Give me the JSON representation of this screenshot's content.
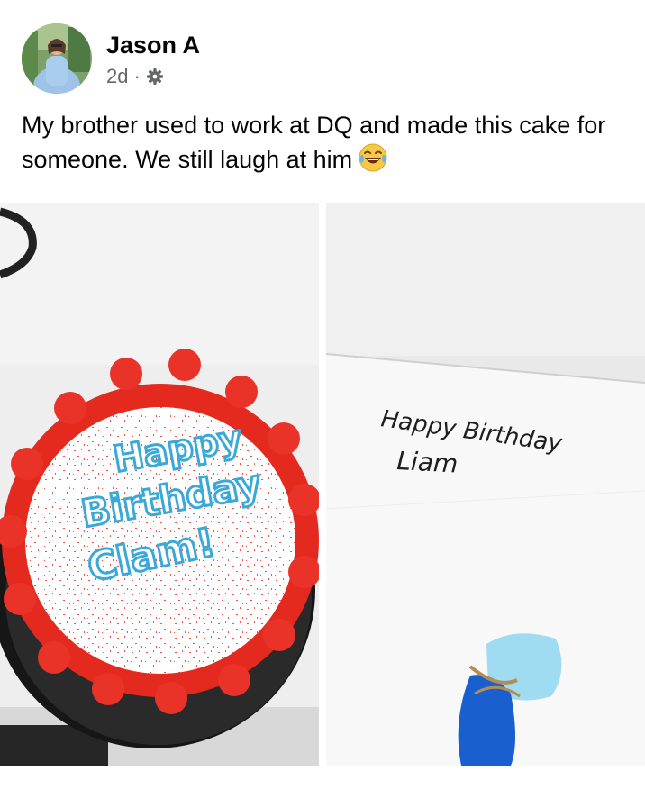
{
  "post": {
    "author": "Jason A",
    "timestamp": "2d",
    "separator": "·",
    "privacy_icon": "gear-icon",
    "text": "My brother used to work at DQ and made this cake for someone. We still laugh at him",
    "emoji": "face-with-tears-of-joy"
  },
  "photos": {
    "cake": {
      "icing_line1": "Happy",
      "icing_line2": "Birthday",
      "icing_line3": "Clam!",
      "icing_color": "#3aa9d8",
      "border_color": "#e8281e"
    },
    "note": {
      "line1": "Happy Birthday",
      "line2": "Liam"
    }
  }
}
